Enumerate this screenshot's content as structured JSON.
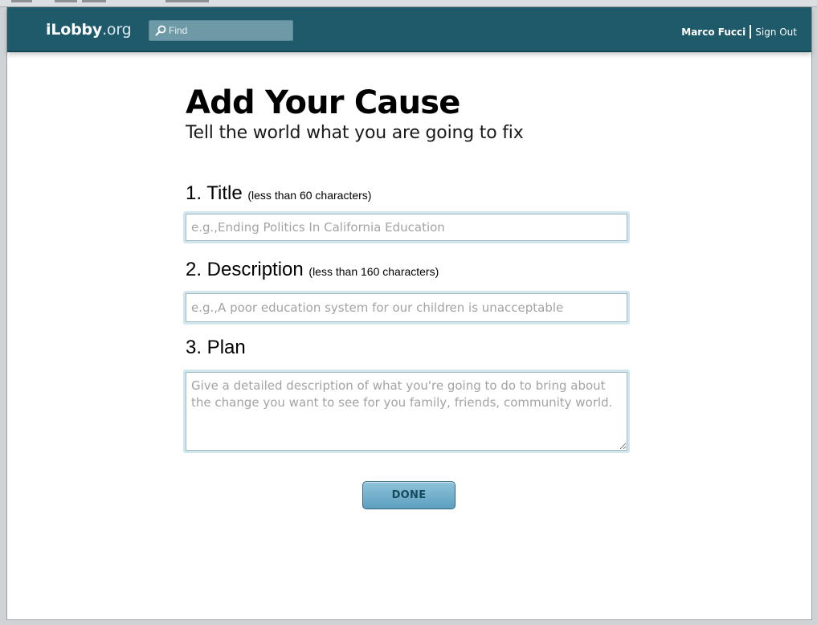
{
  "header": {
    "logo_main": "iLobby",
    "logo_tld": ".org",
    "search_placeholder": "Find",
    "user_name": "Marco Fucci",
    "sign_out_label": "Sign Out"
  },
  "page": {
    "title": "Add Your Cause",
    "subtitle": "Tell the world what you are going to fix"
  },
  "form": {
    "title_field": {
      "label": "1. Title",
      "hint": "(less than 60 characters)",
      "value": "",
      "placeholder": "e.g.,Ending Politics In California Education"
    },
    "description_field": {
      "label": "2. Description",
      "hint": "(less than 160 characters)",
      "value": "",
      "placeholder": "e.g.,A poor education system for our children is unacceptable"
    },
    "plan_field": {
      "label": "3. Plan",
      "value": "",
      "placeholder": "Give a detailed description of what you're going to do to bring about the change you want to see for you family, friends, community world."
    },
    "done_label": "DONE"
  },
  "icons": {
    "search": "search-icon",
    "resize": "resize-grip-icon"
  },
  "colors": {
    "header_bg": "#1f5a6b",
    "search_bg": "#6e9aa8",
    "input_glow": "#d2e6ee",
    "button_top": "#8ec3da",
    "button_bottom": "#5d9fbf",
    "button_text": "#174a5e"
  }
}
